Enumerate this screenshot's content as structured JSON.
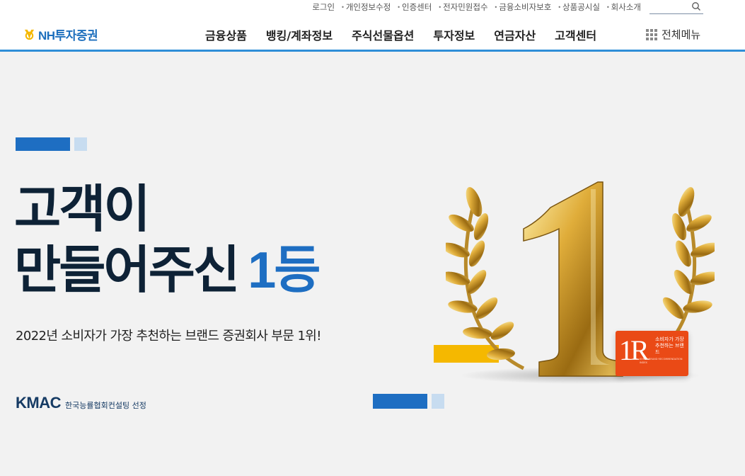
{
  "header": {
    "util_links": [
      "로그인",
      "개인정보수정",
      "인증센터",
      "전자민원접수",
      "금융소비자보호",
      "상품공시실",
      "회사소개"
    ],
    "logo_text": "NH투자증권",
    "nav": [
      "금융상품",
      "뱅킹/계좌정보",
      "주식선물옵션",
      "투자정보",
      "연금자산",
      "고객센터"
    ],
    "all_menu": "전체메뉴"
  },
  "hero": {
    "headline_line1": "고객이",
    "headline_line2": "만들어주신",
    "headline_highlight": "1등",
    "subtitle": "2022년 소비자가 가장 추천하는 브랜드 증권회사 부문 1위!",
    "kmac_logo": "KMAC",
    "kmac_desc": "한국능률협회컨설팅 선정",
    "badge_mark": "1R",
    "badge_text": "소비자가 가장 추천하는 브랜드",
    "badge_small": "KOREA BRAND RECOMMENDATION INDEX",
    "colors": {
      "blue": "#1e6ec2",
      "light_blue": "#c7dcf0",
      "yellow": "#f5b800",
      "badge": "#ea4a16",
      "navy": "#0e2236"
    }
  }
}
